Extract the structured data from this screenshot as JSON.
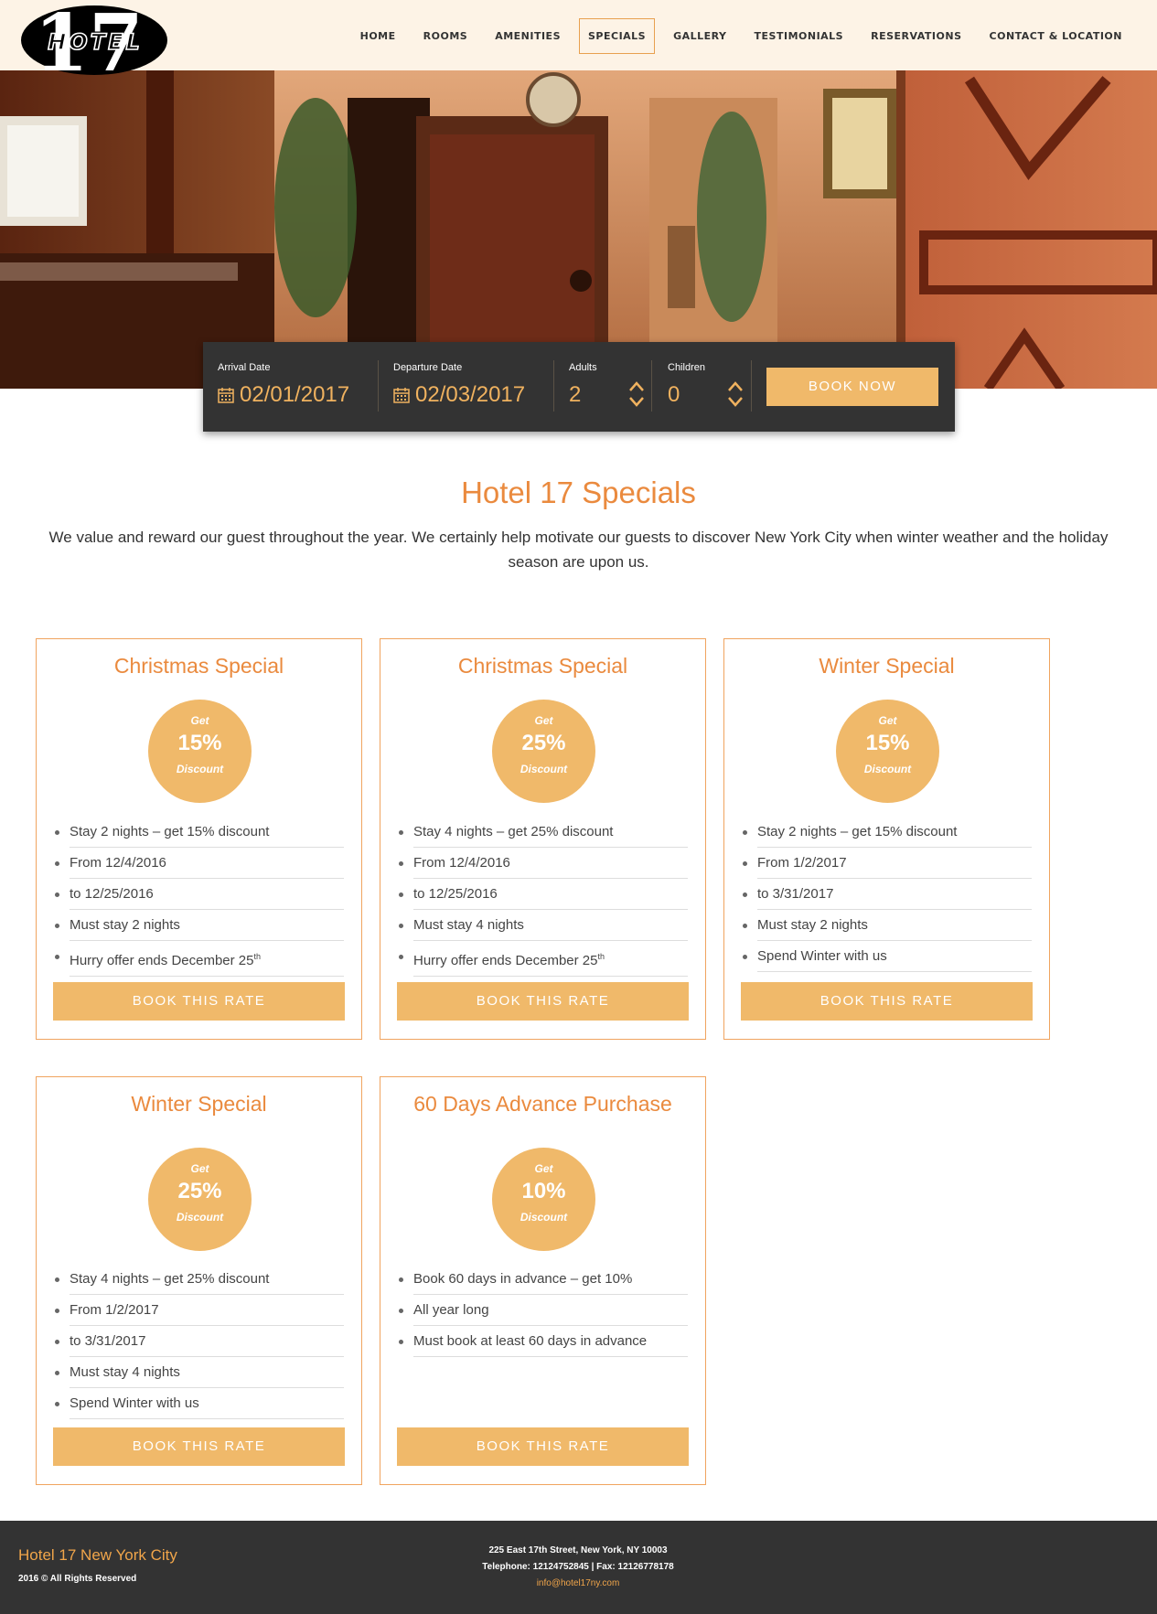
{
  "header": {
    "logo_text_number": "17",
    "logo_text_word": "HOTEL",
    "nav": [
      {
        "label": "HOME"
      },
      {
        "label": "ROOMS"
      },
      {
        "label": "AMENITIES"
      },
      {
        "label": "SPECIALS",
        "active": true
      },
      {
        "label": "GALLERY"
      },
      {
        "label": "TESTIMONIALS"
      },
      {
        "label": "RESERVATIONS"
      },
      {
        "label": "CONTACT & LOCATION"
      }
    ]
  },
  "booking": {
    "arrival_label": "Arrival Date",
    "arrival_value": "02/01/2017",
    "departure_label": "Departure Date",
    "departure_value": "02/03/2017",
    "adults_label": "Adults",
    "adults_value": "2",
    "children_label": "Children",
    "children_value": "0",
    "book_now_label": "BOOK NOW"
  },
  "intro": {
    "title": "Hotel 17 Specials",
    "text": "We value and reward our guest throughout the year. We certainly help motivate our guests to discover New York City when winter weather and the holiday season are upon us."
  },
  "specials": [
    {
      "title": "Christmas Special",
      "badge_get": "Get",
      "badge_pct": "15%",
      "badge_disc": "Discount",
      "items": [
        "Stay 2 nights – get 15% discount",
        "From 12/4/2016",
        "to 12/25/2016",
        "Must stay 2 nights",
        "Hurry offer ends December 25"
      ],
      "last_sup": "th",
      "button": "BOOK THIS RATE"
    },
    {
      "title": "Christmas Special",
      "badge_get": "Get",
      "badge_pct": "25%",
      "badge_disc": "Discount",
      "items": [
        "Stay 4 nights – get 25% discount",
        "From 12/4/2016",
        "to 12/25/2016",
        "Must stay 4 nights",
        "Hurry offer ends December 25"
      ],
      "last_sup": "th",
      "button": "BOOK THIS RATE"
    },
    {
      "title": "Winter Special",
      "badge_get": "Get",
      "badge_pct": "15%",
      "badge_disc": "Discount",
      "items": [
        "Stay 2 nights – get 15% discount",
        "From 1/2/2017",
        "to 3/31/2017",
        "Must stay 2 nights",
        "Spend Winter with us"
      ],
      "last_sup": "",
      "button": "BOOK THIS RATE"
    },
    {
      "title": "Winter Special",
      "badge_get": "Get",
      "badge_pct": "25%",
      "badge_disc": "Discount",
      "items": [
        "Stay 4 nights – get 25% discount",
        "From 1/2/2017",
        "to 3/31/2017",
        "Must stay 4 nights",
        "Spend Winter with us"
      ],
      "last_sup": "",
      "button": "BOOK THIS RATE"
    },
    {
      "title": "60 Days Advance Purchase",
      "badge_get": "Get",
      "badge_pct": "10%",
      "badge_disc": "Discount",
      "items": [
        "Book 60 days in advance – get 10%",
        "All year long",
        "Must book at least 60 days in advance"
      ],
      "last_sup": "",
      "button": "BOOK THIS RATE"
    }
  ],
  "footer": {
    "name": "Hotel 17 New York City",
    "copyright": "2016 © All Rights Reserved",
    "address": "225 East 17th Street, New York, NY 10003",
    "phone": "Telephone: 12124752845 | Fax: 12126778178",
    "email": "info@hotel17ny.com"
  },
  "colors": {
    "accent": "#ea8a3e",
    "button": "#f0b96a",
    "dark": "#333333",
    "header_bg": "#fdf3e6"
  }
}
